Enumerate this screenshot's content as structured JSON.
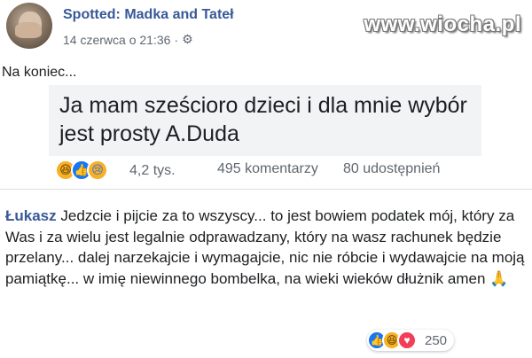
{
  "header": {
    "page_name": "Spotted: Madka and Tateł",
    "timestamp": "14 czerwca o 21:36",
    "separator": "·",
    "settings_icon": "gear-icon",
    "watermark": "www.wiocha.pl"
  },
  "post": {
    "text": "Na koniec...",
    "shared_text": "Ja mam sześcioro dzieci i dla mnie wybór jest prosty A.Duda",
    "reactions": [
      "haha-icon",
      "like-icon",
      "sad-icon"
    ],
    "reaction_count": "4,2 tys.",
    "comments_count": "495 komentarzy",
    "shares_count": "80 udostępnień"
  },
  "comment": {
    "author": "Łukasz",
    "text": "Jedzcie i pijcie za to wszyscy... to jest bowiem podatek mój, który za Was i za wielu jest legalnie odprawadzany, który na wasz rachunek będzie przelany... dalej narzekajcie i wymagajcie, nic nie róbcie i wydawajcie na moją pamiątkę... w imię niewinnego bombelka, na wieki wieków dłużnik amen",
    "emoji": "🙏",
    "reactions": [
      "like-icon",
      "haha-icon",
      "love-icon"
    ],
    "reaction_count": "250"
  },
  "colors": {
    "link_blue": "#385898",
    "secondary_text": "#606770",
    "shared_box_bg": "#f2f3f5",
    "like_blue": "#1877f2",
    "haha_yellow": "#f7b125",
    "love_red": "#f33e58"
  }
}
